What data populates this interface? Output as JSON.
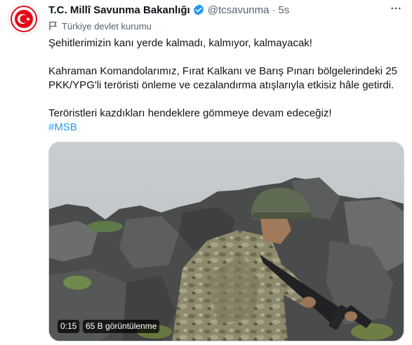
{
  "account": {
    "display_name": "T.C. Millî Savunma Bakanlığı",
    "handle": "@tcsavunma",
    "separator": "·",
    "time": "5s",
    "label": "Türkiye devlet kurumu"
  },
  "tweet": {
    "line1": "Şehitlerimizin kanı yerde kalmadı, kalmıyor, kalmayacak!",
    "line2": "Kahraman Komandolarımız, Fırat Kalkanı ve Barış Pınarı bölgelerindeki  25",
    "line3": "PKK/YPG'li teröristi önleme ve cezalandırma atışlarıyla etkisiz hâle getirdi.",
    "line4": "Teröristleri kazdıkları hendeklere gömmeye devam edeceğiz!",
    "hashtag": "#MSB"
  },
  "video": {
    "duration": "0:15",
    "views": "65 B görüntülenme"
  },
  "colors": {
    "accent": "#1d9bf0",
    "verified": "#1d9bf0",
    "text_primary": "#0f1419",
    "text_secondary": "#536471",
    "logo_red": "#e30a17"
  },
  "icons": {
    "avatar": "msb-logo-icon",
    "verified": "verified-badge-icon",
    "label": "flag-icon",
    "more": "more-options-icon"
  }
}
